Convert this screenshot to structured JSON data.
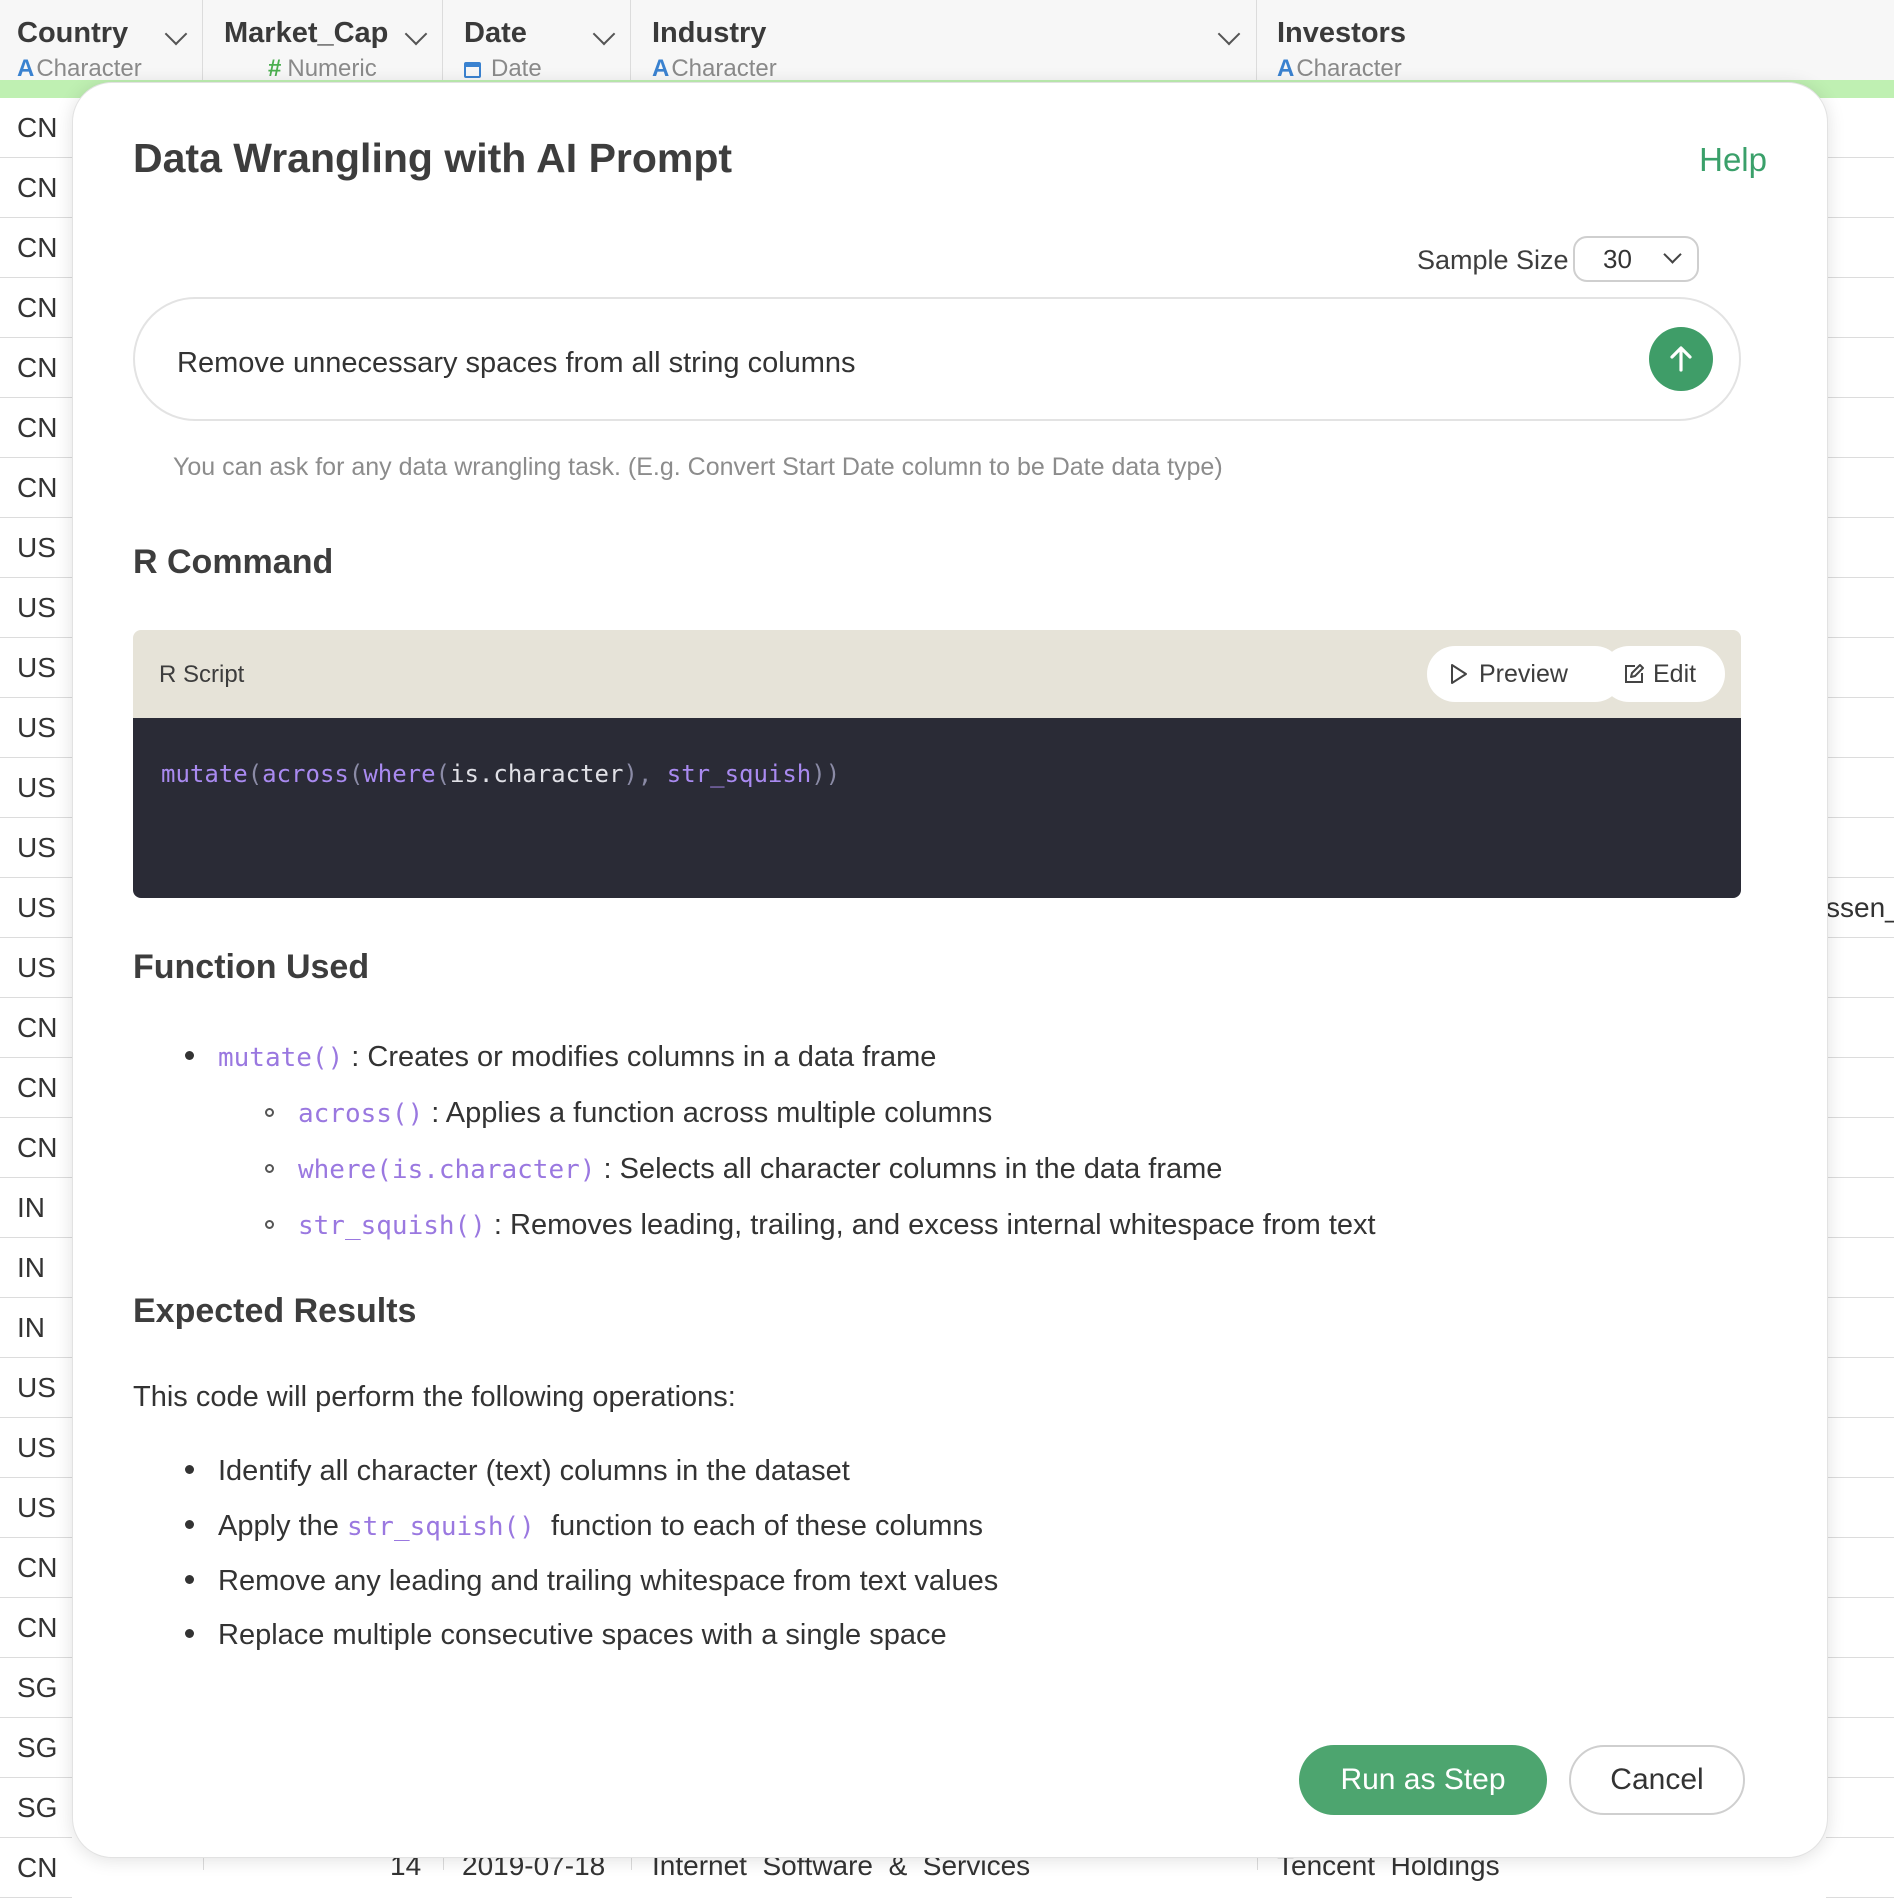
{
  "grid": {
    "columns": [
      {
        "name": "Country",
        "type": "Character"
      },
      {
        "name": "Market_Cap",
        "type": "Numeric"
      },
      {
        "name": "Date",
        "type": "Date"
      },
      {
        "name": "Industry",
        "type": "Character"
      },
      {
        "name": "Investors",
        "type": "Character"
      }
    ],
    "rows": [
      "CN",
      "CN",
      "CN",
      "CN",
      "CN",
      "CN",
      "CN",
      "US",
      "US",
      "US",
      "US",
      "US",
      "US",
      "US",
      "US",
      "CN",
      "CN",
      "CN",
      "IN",
      "IN",
      "IN",
      "US",
      "US",
      "US",
      "CN",
      "CN",
      "SG",
      "SG",
      "SG",
      "CN"
    ],
    "peek_right": "ssen_",
    "bottom_row": {
      "market_cap": "14",
      "date": "2019-07-18",
      "industry": "Internet  Software  &  Services",
      "investors": "Tencent  Holdings"
    }
  },
  "modal": {
    "title": "Data Wrangling with AI Prompt",
    "help": "Help",
    "sample_size_label": "Sample Size",
    "sample_size_value": "30",
    "prompt_text": "Remove unnecessary spaces from all string columns",
    "hint": "You can ask for any data wrangling task. (E.g. Convert Start Date column to be Date data type)",
    "r_command_title": "R Command",
    "script_label": "R Script",
    "preview_label": "Preview",
    "edit_label": "Edit",
    "code": {
      "fn1": "mutate",
      "p1": "(",
      "fn2": "across",
      "p2": "(",
      "fn3": "where",
      "p3": "(",
      "arg": "is.character",
      "p4": "), ",
      "fn4": "str_squish",
      "p5": "))"
    },
    "function_used_title": "Function Used",
    "functions": [
      {
        "code": "mutate()",
        "desc": " : Creates or modifies columns in a data frame"
      },
      {
        "code": "across()",
        "desc": " : Applies a function across multiple columns"
      },
      {
        "code": "where(is.character)",
        "desc": " : Selects all character columns in the data frame"
      },
      {
        "code": "str_squish()",
        "desc": " : Removes leading, trailing, and excess internal whitespace from text"
      }
    ],
    "expected_title": "Expected Results",
    "expected_intro": "This code will perform the following operations:",
    "expected": {
      "item1": "Identify all character (text) columns in the dataset",
      "item2_pre": "Apply the ",
      "item2_code": "str_squish()",
      "item2_post": "  function to each of these columns",
      "item3": "Remove any leading and trailing whitespace from text values",
      "item4": "Replace multiple consecutive spaces with a single space"
    },
    "run_label": "Run as Step",
    "cancel_label": "Cancel"
  },
  "colors": {
    "accent": "#4da56f",
    "code_bg": "#2a2b36",
    "code_fn": "#a98af0",
    "help": "#3aa06a"
  }
}
